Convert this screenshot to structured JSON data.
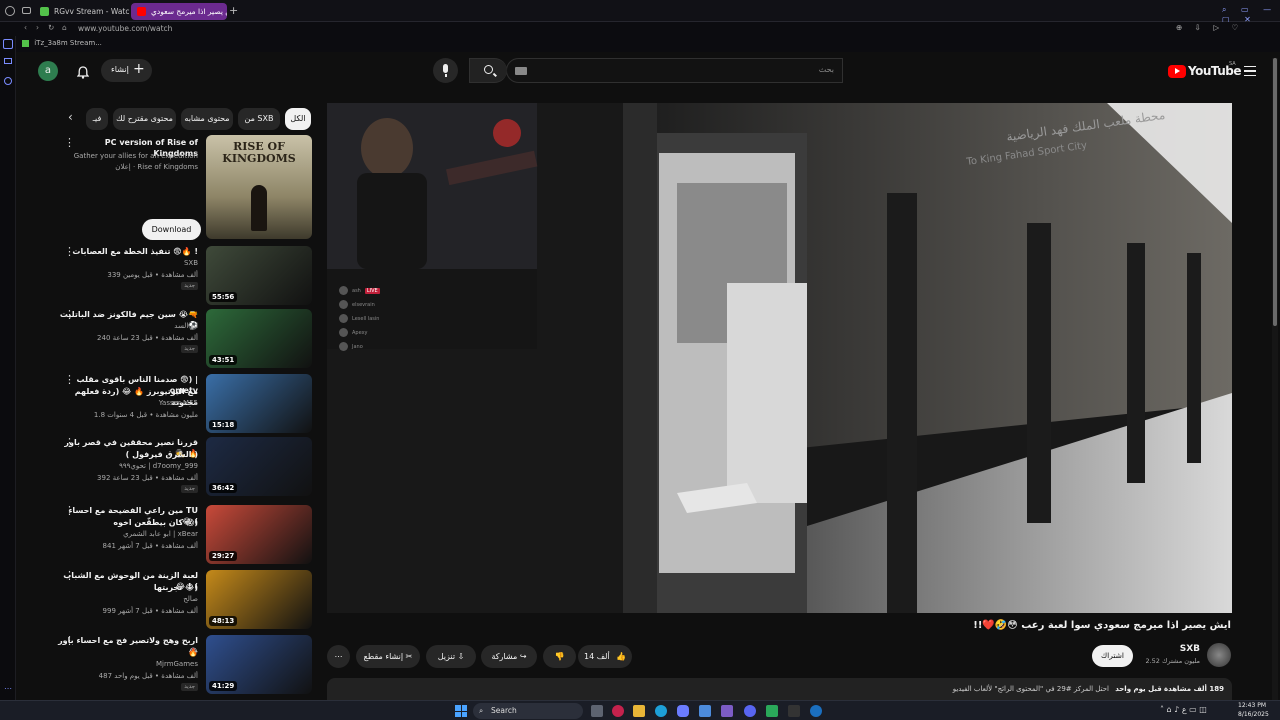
{
  "browser": {
    "tabs": [
      {
        "label": "RGvv Stream - Watch Live"
      },
      {
        "label": "ايش يصير اذا ميرمج سعودي"
      }
    ],
    "url": "www.youtube.com/watch",
    "bookmark": "iTz_3a8m Stream..."
  },
  "header": {
    "logo_text": "YouTube",
    "region": "SA",
    "search_placeholder": "بحث",
    "create_label": "إنشاء",
    "avatar_letter": "a"
  },
  "chips": [
    {
      "label": "الكل",
      "active": true
    },
    {
      "label": "من SXB"
    },
    {
      "label": "محتوى مشابه"
    },
    {
      "label": "محتوى مقترح لك"
    },
    {
      "label": "فيـ"
    }
  ],
  "ad": {
    "title": "PC version of Rise of Kingdoms",
    "desc": "Gather your allies for an expedition",
    "sponsor": "إعلان · Rise of Kingdoms",
    "button": "Download",
    "thumb_text": "RISE OF KINGDOMS"
  },
  "videos": [
    {
      "title": "تنفيذ الخطة مع العصابات 😨🔥 !",
      "channel": "SXB",
      "meta": "339 ألف مشاهدة • قبل يومين",
      "badge": "جديد",
      "duration": "55:56",
      "color": "#3f4a3a"
    },
    {
      "title": "سين جيم فالكونز ضد الباتليت 😭🔫 ⚽",
      "channel": "ابو السد",
      "meta": "240 ألف مشاهدة • قبل 23 ساعة",
      "badge": "جديد",
      "duration": "43:51",
      "color": "#2d6a3a"
    },
    {
      "title": "صدمنا الناس باقوى مقلب 😨) | ometv",
      "title2": "مع اليوتيوبرز 🔥 😂 (ردة فعلهم مجنونة",
      "channel": "Yasser M55",
      "meta": "1.8 مليون مشاهدة • قبل 4 سنوات",
      "badge": "",
      "duration": "15:18",
      "color": "#3a6fa8"
    },
    {
      "title": "قررنا نصير محققين في قصر باور 🕵️ 🔥",
      "title2": "( السرق فيرفول )",
      "channel": "تحوي٩٩٩ | d7oomy_999",
      "meta": "392 ألف مشاهدة • قبل 23 ساعة",
      "badge": "جديد",
      "duration": "36:42",
      "color": "#1d2a44"
    },
    {
      "title": "مين راعي الفضيحة مع احساء TU 😂 (",
      "title2": "كان بيطقّعن اخوه 😱)",
      "channel": "ابو عابد الشمري | xBear",
      "meta": "841 ألف مشاهدة • قبل 7 أشهر",
      "badge": "",
      "duration": "29:27",
      "color": "#c94a3a"
    },
    {
      "title": "لعبة الزينة من الوحوش مع الشباب 😂 ! (",
      "title2": "تجربتها 😂)",
      "channel": "صالح",
      "meta": "999 ألف مشاهدة • قبل 7 أشهر",
      "badge": "",
      "duration": "48:13",
      "color": "#c58a1a"
    },
    {
      "title": "اربح وهج ولاتصير فج مع احساء باور 😂",
      "title2": "🔥",
      "channel": "MjrmGames",
      "meta": "487 ألف مشاهدة • قبل يوم واحد",
      "badge": "جديد",
      "duration": "41:29",
      "color": "#2f4f8f"
    }
  ],
  "player": {
    "sign_text_ar": "محطة ملعب الملك فهد الرياضية",
    "sign_text_en": "To King Fahad Sport City",
    "chat": [
      {
        "name": "ash",
        "tag": "LIVE"
      },
      {
        "name": "elsevrain"
      },
      {
        "name": "Lesell lasin"
      },
      {
        "name": "Apexy"
      },
      {
        "name": "Jano"
      }
    ]
  },
  "video_info": {
    "title": "ايش يصير اذا ميرمج سعودي سوا لعبة رعب 😳🤣❤️!!",
    "channel": "SXB",
    "subs": "2.52 مليون مشترك",
    "subscribe": "اشتراك",
    "likes": "14 ألف",
    "share": "مشاركة",
    "download": "تنزيل",
    "clip": "إنشاء مقطع",
    "views": "189 ألف مشاهدة",
    "date": "قبل يوم واحد",
    "desc": "احتل المركز #29 في \"المحتوى الرائج\" لألعاب الفيديو"
  },
  "taskbar": {
    "search": "Search",
    "time": "12:43 PM",
    "date": "8/16/2025"
  },
  "colors": {
    "bg": "#0f0f0f",
    "chip": "#272727",
    "yt_red": "#ff0000",
    "tab_active": "#6b2a8f"
  }
}
